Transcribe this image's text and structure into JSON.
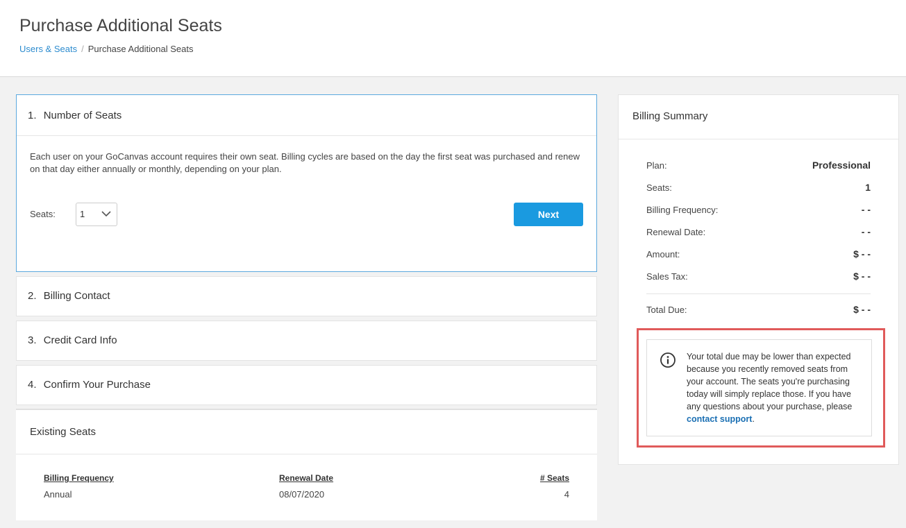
{
  "header": {
    "title": "Purchase Additional Seats",
    "breadcrumb": {
      "link": "Users & Seats",
      "separator": "/",
      "current": "Purchase Additional Seats"
    }
  },
  "steps": [
    {
      "number": "1.",
      "title": "Number of Seats"
    },
    {
      "number": "2.",
      "title": "Billing Contact"
    },
    {
      "number": "3.",
      "title": "Credit Card Info"
    },
    {
      "number": "4.",
      "title": "Confirm Your Purchase"
    }
  ],
  "step1": {
    "description": "Each user on your GoCanvas account requires their own seat. Billing cycles are based on the day the first seat was purchased and renew on that day either annually or monthly, depending on your plan.",
    "seats_label": "Seats:",
    "seats_value": "1",
    "next_label": "Next"
  },
  "existing": {
    "title": "Existing Seats",
    "headers": [
      "Billing Frequency",
      "Renewal Date",
      "# Seats"
    ],
    "row": [
      "Annual",
      "08/07/2020",
      "4"
    ]
  },
  "billing": {
    "title": "Billing Summary",
    "rows": [
      {
        "label": "Plan:",
        "value": "Professional"
      },
      {
        "label": "Seats:",
        "value": "1"
      },
      {
        "label": "Billing Frequency:",
        "value": "- -"
      },
      {
        "label": "Renewal Date:",
        "value": "- -"
      },
      {
        "label": "Amount:",
        "value": "$ - -"
      },
      {
        "label": "Sales Tax:",
        "value": "$ - -"
      }
    ],
    "total": {
      "label": "Total Due:",
      "value": "$ - -"
    },
    "notice": {
      "icon": "info-icon",
      "text": "Your total due may be lower than expected because you recently removed seats from your account. The seats you're purchasing today will simply replace those. If you have any questions about your purchase, please ",
      "link": "contact support",
      "end": "."
    }
  },
  "colors": {
    "accent": "#1a9ae0",
    "link": "#2d8ccf",
    "highlight_border": "#e05a5a"
  }
}
